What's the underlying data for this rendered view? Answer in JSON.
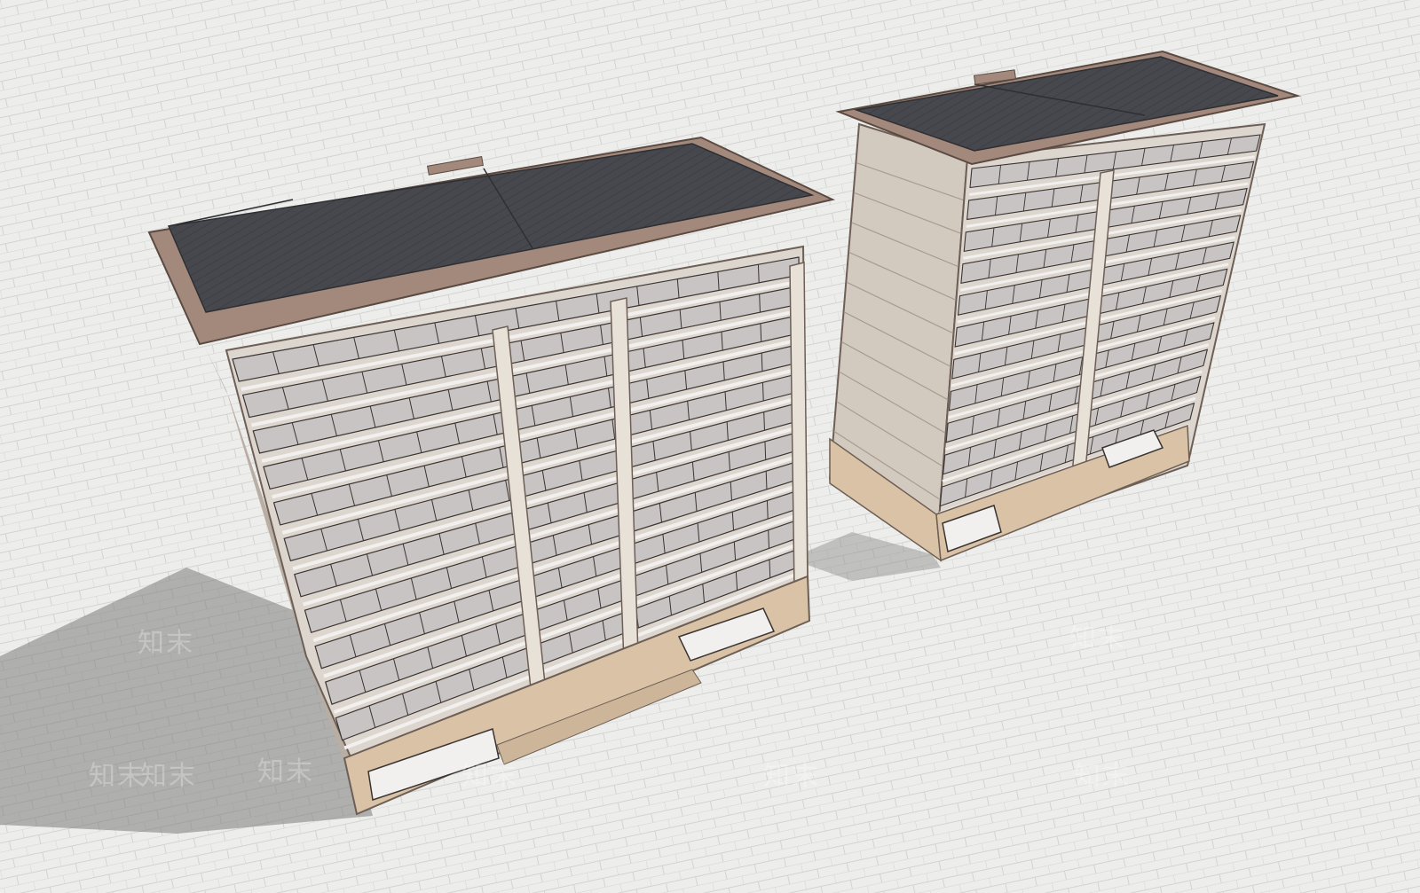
{
  "scene": {
    "ground_color": "#ededeb",
    "tile_line_color": "#d3d3d1",
    "shadow_color": "#7b7b7b",
    "roof_color": "#45474c",
    "roof_trim_color": "#a3897c",
    "facade_color": "#ddd6ce",
    "wall_color": "#d2c9bf",
    "glass_color": "#c7c4c3",
    "frame_color": "#3a3432",
    "base_stone_color": "#d9c2a5",
    "railing_color": "#f2f0ee"
  },
  "watermarks": [
    {
      "text": "知末"
    },
    {
      "text": "知末"
    },
    {
      "text": "知末"
    },
    {
      "text": "知末"
    },
    {
      "text": "知末"
    },
    {
      "text": "知末"
    },
    {
      "text": "知末"
    },
    {
      "text": "知末"
    }
  ],
  "buildings": [
    {
      "name": "left-building",
      "floors": 11
    },
    {
      "name": "right-building",
      "floors": 11
    }
  ]
}
